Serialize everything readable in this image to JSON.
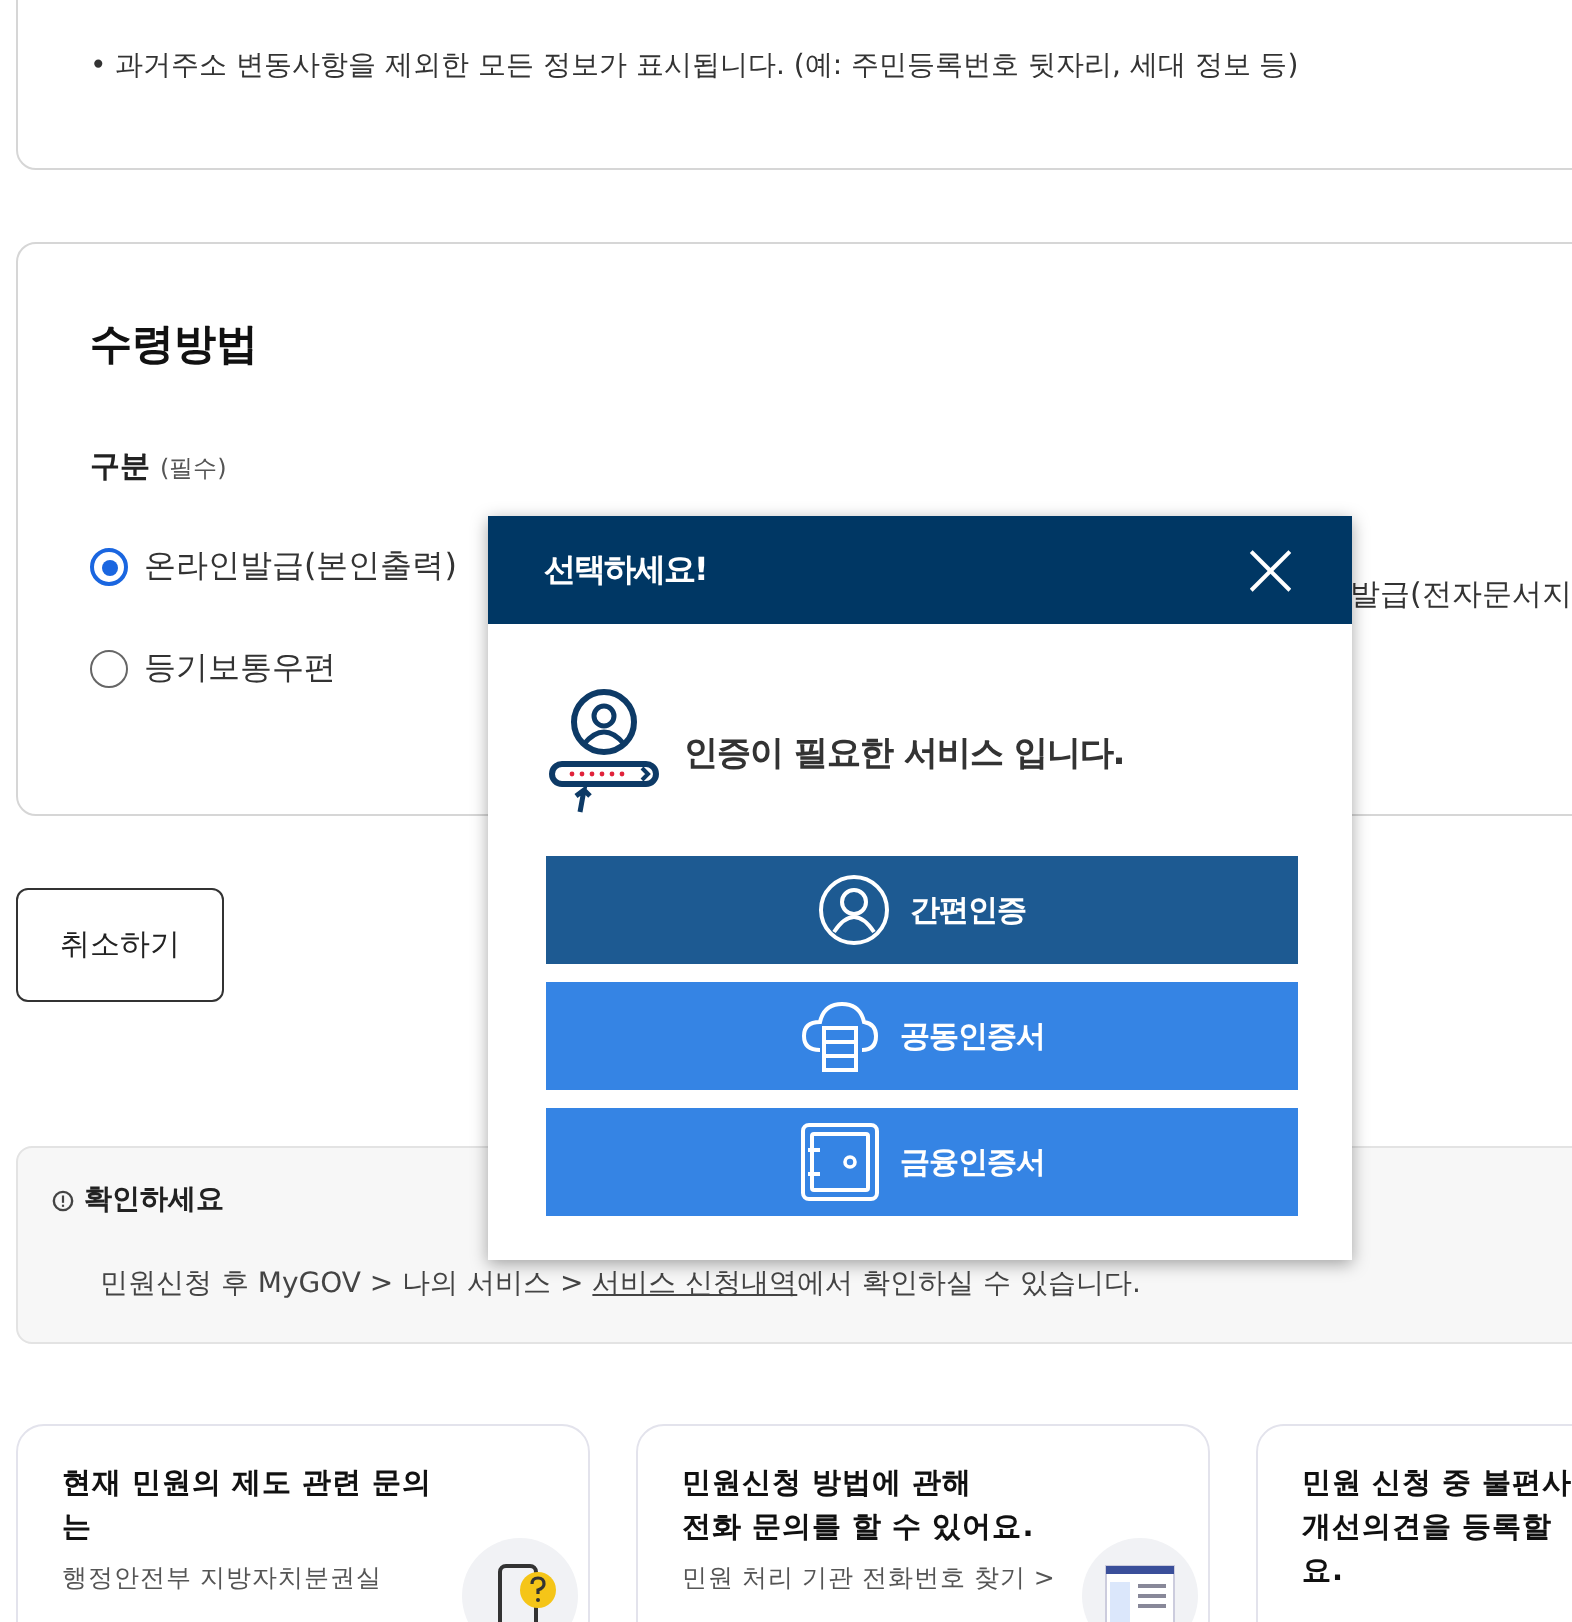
{
  "info_note": "• 과거주소 변동사항을 제외한 모든 정보가 표시됩니다. (예: 주민등록번호 뒷자리, 세대 정보 등)",
  "receipt": {
    "title": "수령방법",
    "field_label": "구분",
    "field_hint": "(필수)",
    "options": [
      {
        "label": "온라인발급(본인출력)",
        "selected": true
      },
      {
        "label": "등기보통우편",
        "selected": false
      }
    ],
    "partial_option": "발급(전자문서지"
  },
  "cancel_button": "취소하기",
  "notice": {
    "title": "확인하세요",
    "before": "민원신청 후 MyGOV > 나의 서비스 > ",
    "link": "서비스 신청내역",
    "after": "에서 확인하실 수 있습니다."
  },
  "help_cards": [
    {
      "lines": [
        "현재 민원의 제도 관련 문의",
        "는"
      ],
      "link": "행정안전부 지방자치분권실",
      "kind": "phone"
    },
    {
      "lines": [
        "민원신청 방법에 관해",
        "전화 문의를 할 수 있어요."
      ],
      "link": "민원 처리 기관 전화번호 찾기 >",
      "kind": "document"
    },
    {
      "lines": [
        "민원 신청 중 불편사",
        "개선의견을 등록할",
        "요."
      ],
      "kind": "plain"
    }
  ],
  "modal": {
    "title": "선택하세요!",
    "close": "×",
    "message": "인증이 필요한 서비스 입니다.",
    "buttons": [
      {
        "label": "간편인증",
        "kind": "simple"
      },
      {
        "label": "공동인증서",
        "kind": "joint"
      },
      {
        "label": "금융인증서",
        "kind": "financial"
      }
    ]
  }
}
